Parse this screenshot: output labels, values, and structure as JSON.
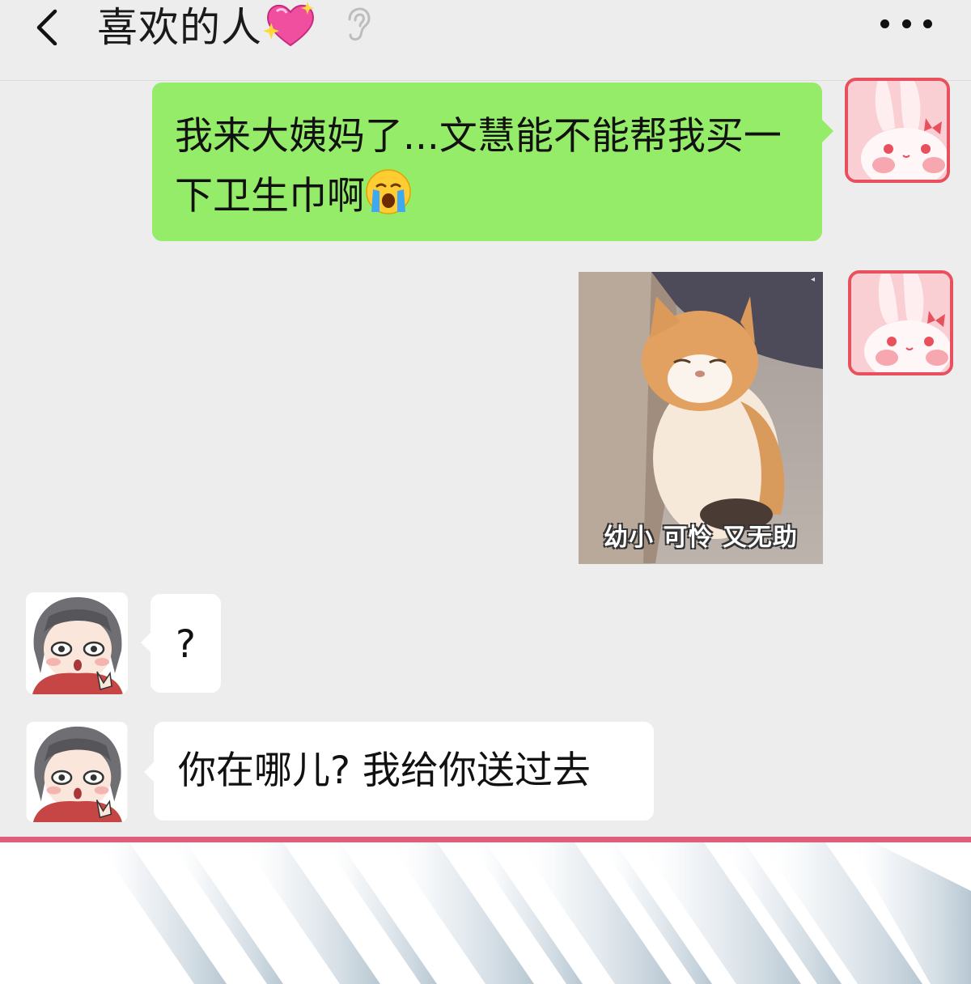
{
  "header": {
    "title": "喜欢的人",
    "title_emoji_icon": "sparkling-heart-icon",
    "ear_icon": "ear-icon",
    "back_icon": "chevron-left-icon",
    "more_icon": "more-dots-icon"
  },
  "messages": [
    {
      "side": "right",
      "type": "text",
      "sender_avatar": "bunny",
      "text": "我来大姨妈了...文慧能不能帮我买一下卫生巾啊",
      "emoji": "crying-face-icon"
    },
    {
      "side": "right",
      "type": "sticker",
      "sender_avatar": "bunny",
      "sticker_caption": "幼小 可怜 又无助"
    },
    {
      "side": "left",
      "type": "text",
      "sender_avatar": "girl",
      "text": "?"
    },
    {
      "side": "left",
      "type": "text",
      "sender_avatar": "girl",
      "text": "你在哪儿? 我给你送过去"
    }
  ],
  "colors": {
    "background": "#ededed",
    "sent_bubble": "#95ec69",
    "received_bubble": "#ffffff",
    "accent_line": "#e25d79"
  }
}
